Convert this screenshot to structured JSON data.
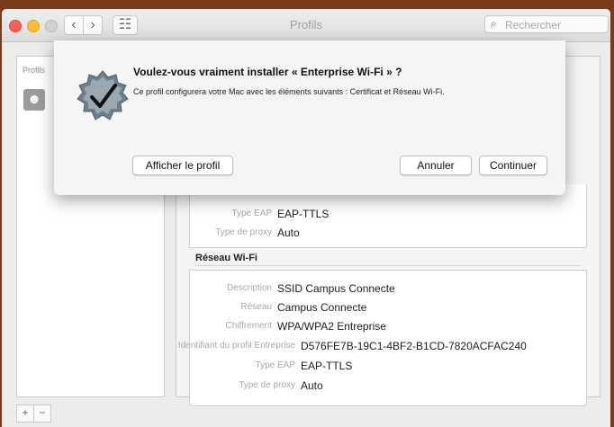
{
  "window": {
    "title": "Profils",
    "search_placeholder": "Rechercher",
    "back_glyph": "‹",
    "forward_glyph": "›",
    "grid_glyph": "☷"
  },
  "sidebar": {
    "header": "Profils",
    "profile_icon_glyph": "☻"
  },
  "dialog": {
    "title": "Voulez-vous vraiment installer « Enterprise Wi-Fi » ?",
    "message": "Ce profil configurera votre Mac avec les éléments suivants : Certificat et Réseau Wi-Fi.",
    "show_profile_label": "Afficher le profil",
    "cancel_label": "Annuler",
    "continue_label": "Continuer"
  },
  "details_upper": {
    "rows": [
      {
        "key": "Type EAP",
        "value": "EAP-TTLS"
      },
      {
        "key": "Type de proxy",
        "value": "Auto"
      }
    ]
  },
  "wifi_section": {
    "heading": "Réseau Wi-Fi",
    "rows": [
      {
        "key": "Description",
        "value": "SSID Campus Connecte"
      },
      {
        "key": "Réseau",
        "value": "Campus Connecte"
      },
      {
        "key": "Chiffrement",
        "value": "WPA/WPA2 Entreprise"
      },
      {
        "key": "Identifiant du profil Entreprise",
        "value": "D576FE7B-19C1-4BF2-B1CD-7820ACFAC240"
      },
      {
        "key": "Type EAP",
        "value": "EAP-TTLS"
      },
      {
        "key": "Type de proxy",
        "value": "Auto"
      }
    ]
  },
  "bottom": {
    "add_glyph": "+",
    "remove_glyph": "−"
  },
  "colors": {
    "background": "#7a3a1c",
    "close": "#ff5f57",
    "minimize": "#ffbd2e"
  }
}
